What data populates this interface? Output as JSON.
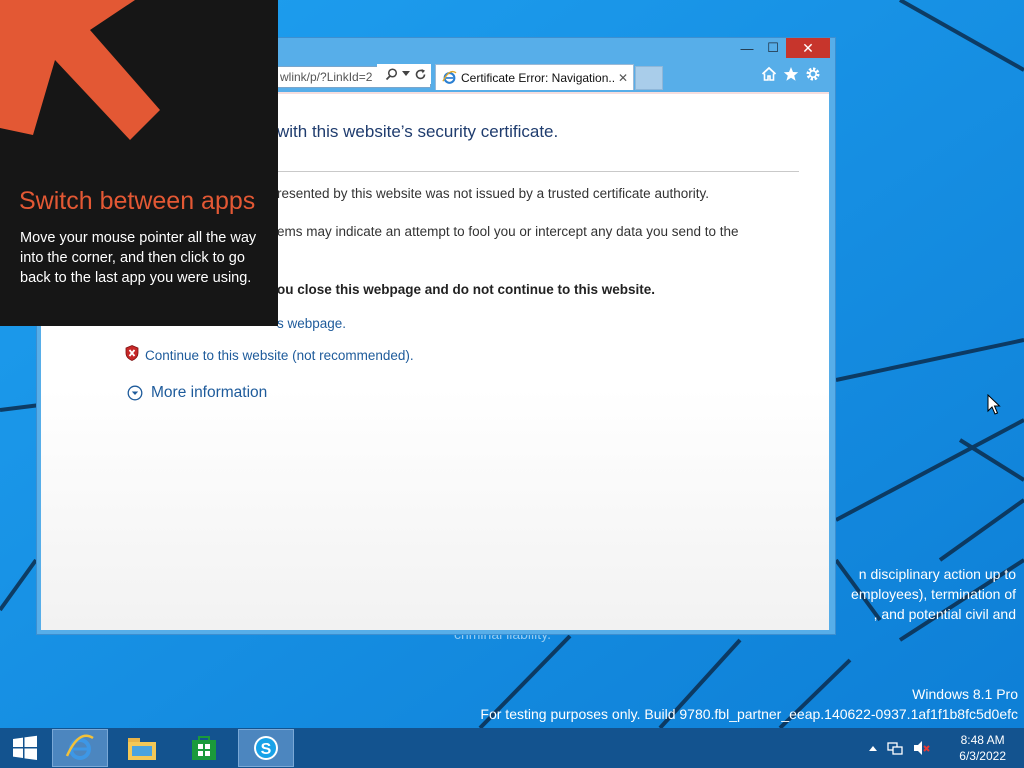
{
  "browser": {
    "address_text": "wlink/p/?LinkId=2",
    "tab_title": "Certificate Error: Navigation...",
    "tab_close": "✕",
    "window_close": "✕",
    "window_minimize": "—",
    "window_maximize": "☐"
  },
  "page": {
    "heading": "with this website’s security certificate.",
    "p1": "resented by this website was not issued by a trusted certificate authority.",
    "p2": "ems may indicate an attempt to fool you or intercept any data you send to the",
    "p3": "ou close this webpage and do not continue to this website.",
    "close_link": "s webpage.",
    "continue_link": "Continue to this website (not recommended).",
    "more_info": "More information"
  },
  "tip": {
    "title": "Switch between apps",
    "body": "Move your mouse pointer all the way into the corner, and then click to go back to the last app you were using."
  },
  "watermark": {
    "legal_lines": [
      "n disciplinary action up to",
      "employees), termination of",
      ", and potential civil and"
    ],
    "legal_faded": "criminal liability.",
    "os_name": "Windows 8.1 Pro",
    "build": "For testing purposes only. Build 9780.fbl_partner_eeap.140622-0937.1af1f1b8fc5d0efc"
  },
  "taskbar": {
    "time": "8:48 AM",
    "date": "6/3/2022"
  },
  "colors": {
    "desktop": "#1a8be3",
    "tip_title": "#e35834",
    "link": "#1e5b9b",
    "close_button": "#c7352c"
  }
}
